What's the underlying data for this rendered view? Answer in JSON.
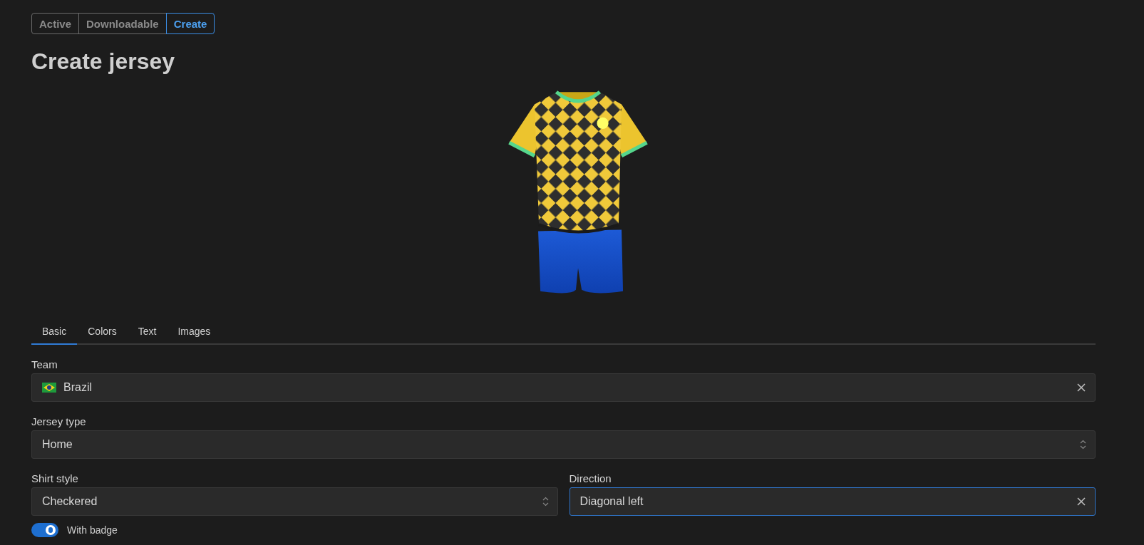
{
  "view_switch": [
    {
      "label": "Active",
      "selected": false
    },
    {
      "label": "Downloadable",
      "selected": false
    },
    {
      "label": "Create",
      "selected": true
    }
  ],
  "title": "Create jersey",
  "tabs": [
    {
      "label": "Basic",
      "selected": true
    },
    {
      "label": "Colors",
      "selected": false
    },
    {
      "label": "Text",
      "selected": false
    },
    {
      "label": "Images",
      "selected": false
    }
  ],
  "team": {
    "label": "Team",
    "value": "Brazil"
  },
  "jersey_type": {
    "label": "Jersey type",
    "value": "Home"
  },
  "shirt_style": {
    "label": "Shirt style",
    "value": "Checkered"
  },
  "direction": {
    "label": "Direction",
    "value": "Diagonal left",
    "focused": true
  },
  "badge_switch": {
    "label": "With badge",
    "on": true
  }
}
